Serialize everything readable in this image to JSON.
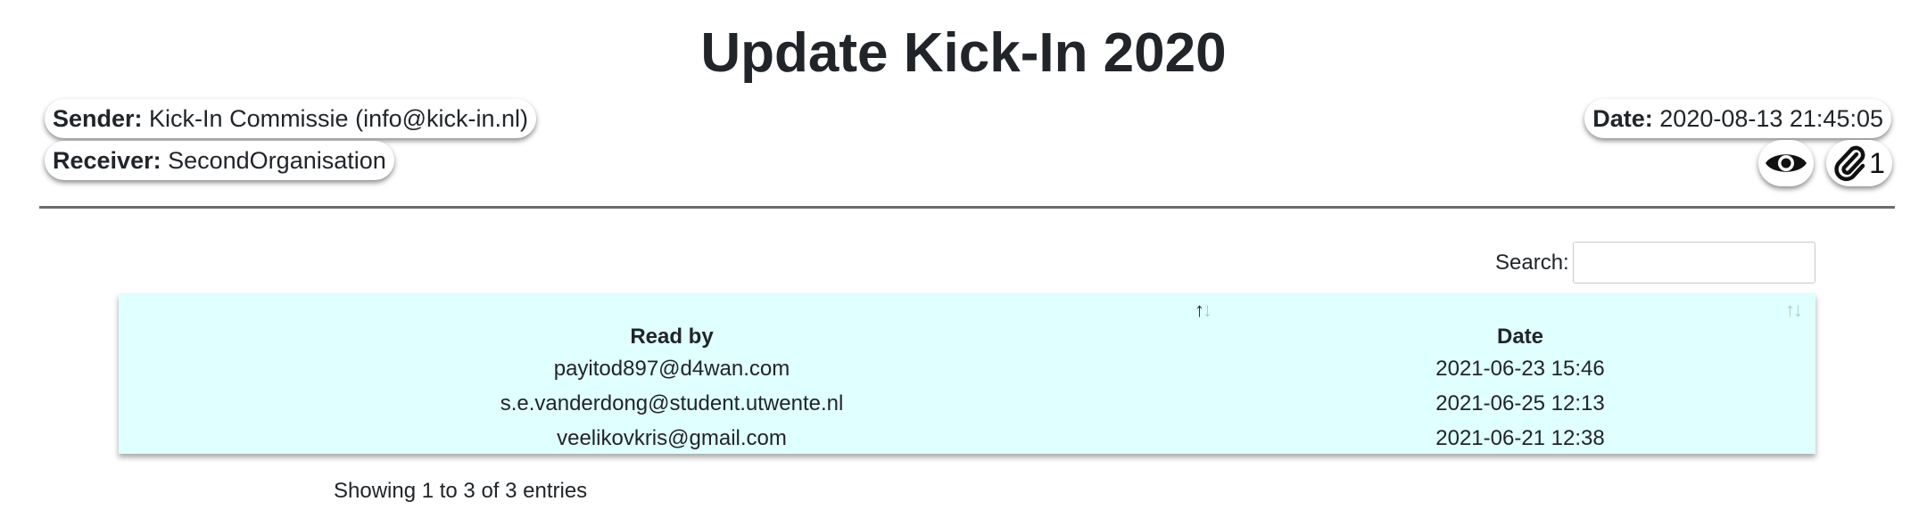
{
  "message": {
    "title": "Update Kick-In 2020",
    "sender_label": "Sender:",
    "sender_value": "Kick-In Commissie (info@kick-in.nl)",
    "receiver_label": "Receiver:",
    "receiver_value": "SecondOrganisation",
    "date_label": "Date:",
    "date_value": "2020-08-13 21:45:05",
    "attachment_count": "1"
  },
  "icons": {
    "view": "eye-icon",
    "attachment": "paperclip-icon"
  },
  "search": {
    "label": "Search:",
    "value": ""
  },
  "table": {
    "columns": [
      "Read by",
      "Date"
    ],
    "sort_glyph_up": "↑",
    "sort_glyph_down": "↓",
    "rows": [
      [
        "payitod897@d4wan.com",
        "2021-06-23 15:46"
      ],
      [
        "s.e.vanderdong@student.utwente.nl",
        "2021-06-25 12:13"
      ],
      [
        "veelikovkris@gmail.com",
        "2021-06-21 12:38"
      ]
    ]
  },
  "footer": {
    "info": "Showing 1 to 3 of 3 entries"
  }
}
